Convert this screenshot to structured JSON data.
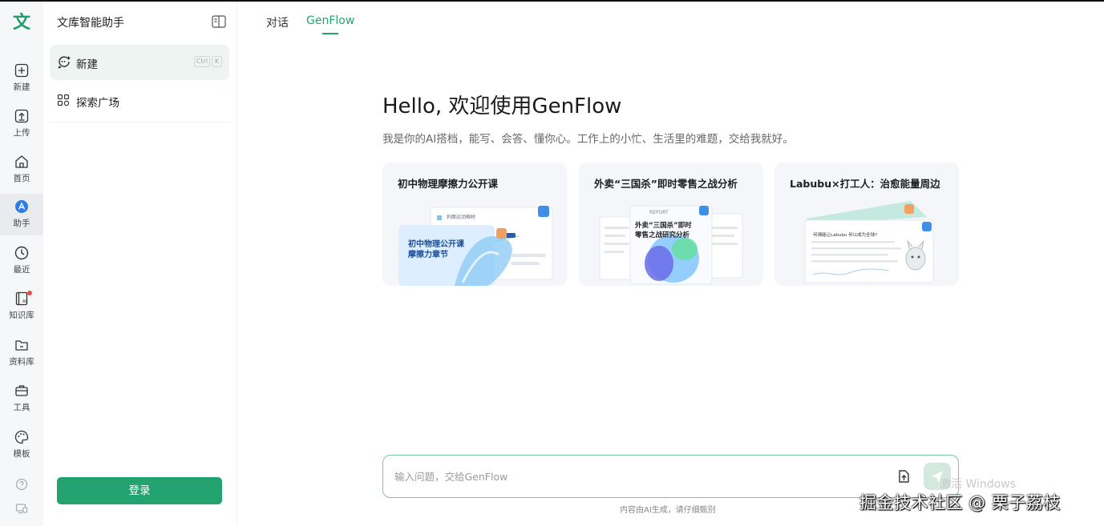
{
  "app": {
    "logo": "文",
    "panel_title": "文库智能助手"
  },
  "rail": {
    "items": [
      {
        "label": "新建",
        "icon": "plus-icon"
      },
      {
        "label": "上传",
        "icon": "upload-icon"
      },
      {
        "label": "首页",
        "icon": "home-icon"
      },
      {
        "label": "助手",
        "icon": "assistant-icon",
        "active": true
      },
      {
        "label": "最近",
        "icon": "clock-icon"
      },
      {
        "label": "知识库",
        "icon": "knowledge-icon",
        "badge": true
      },
      {
        "label": "资料库",
        "icon": "folder-icon"
      },
      {
        "label": "工具",
        "icon": "toolbox-icon"
      },
      {
        "label": "模板",
        "icon": "palette-icon"
      }
    ]
  },
  "panel": {
    "new_label": "新建",
    "new_shortcut": [
      "Ctrl",
      "K"
    ],
    "explore_label": "探索广场",
    "login_label": "登录"
  },
  "tabs": [
    {
      "label": "对话",
      "active": false
    },
    {
      "label": "GenFlow",
      "active": true
    }
  ],
  "main": {
    "hello": "Hello, 欢迎使用GenFlow",
    "subtitle": "我是你的AI搭档，能写、会答、懂你心。工作上的小忙、生活里的难题，交给我就好。",
    "cards": [
      {
        "title": "初中物理摩擦力公开课",
        "art_heading": "初中物理公开课",
        "art_sub": "摩擦力章节",
        "art_tag": "刹面运动棉材"
      },
      {
        "title": "外卖“三国杀”即时零售之战分析",
        "art_heading": "外卖“三国杀”即时",
        "art_sub": "零售之战研究分析",
        "art_tag": "REPORT"
      },
      {
        "title": "Labubu×打工人：治愈能量周边",
        "art_heading": "何谓能让Labubu 何以成为全球?",
        "art_sub": "",
        "art_tag": ""
      }
    ],
    "input_placeholder": "输入问题，交给GenFlow",
    "disclaimer": "内容由AI生成，请仔细甄别"
  },
  "overlay": {
    "activate_windows": "激活 Windows",
    "watermark": "掘金技术社区 @ 栗子荔枝"
  },
  "colors": {
    "accent": "#23a36f",
    "accent_light": "#eef4f1",
    "badge": "#f04a4a"
  }
}
